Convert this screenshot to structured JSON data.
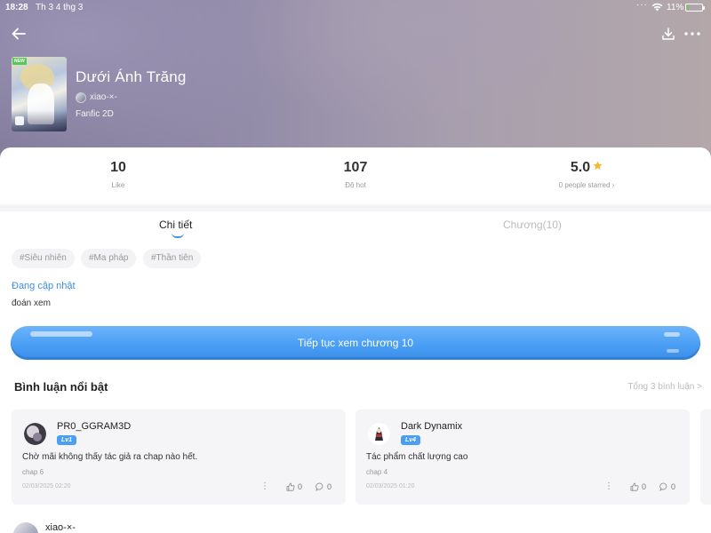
{
  "status_bar": {
    "time": "18:28",
    "date": "Th 3 4 thg 3",
    "battery": "11%",
    "battery_level": 0.11,
    "battery_color": "#5fd35f"
  },
  "nav": {
    "back_icon": "arrow-left-icon",
    "download_icon": "download-icon",
    "more_icon": "more-horizontal-icon"
  },
  "story": {
    "cover_badge": "NEW",
    "title": "Dưới Ánh Trăng",
    "author": "xiao-×-",
    "genre": "Fanfic 2D"
  },
  "stats": {
    "likes_value": "10",
    "likes_label": "Like",
    "hot_value": "107",
    "hot_label": "Độ hot",
    "rating_value": "5.0",
    "rating_label": "0 people starred ›",
    "star_color": "#f5b82e"
  },
  "tabs": [
    {
      "label": "Chi tiết",
      "active": true
    },
    {
      "label": "Chương(10)",
      "active": false
    }
  ],
  "tags": [
    "#Siêu nhiên",
    "#Ma pháp",
    "#Thần tiên"
  ],
  "update_status": "Đang cập nhật",
  "description": "đoán xem",
  "continue_button": "Tiếp tục xem chương 10",
  "accent_color": "#4a9ff5",
  "comments": {
    "heading": "Bình luận nổi bật",
    "total": "Tổng 3 bình luận >",
    "items": [
      {
        "user": "PR0_GGRAM3D",
        "level": "Lv1",
        "text": "Chờ mãi không thấy tác giả ra chap nào hết.",
        "chapter": "chap 6",
        "time": "02/03/2025 02:20",
        "menu": "⋮",
        "likes": "0",
        "replies": "0"
      },
      {
        "user": "Dark Dynamix",
        "level": "Lv4",
        "text": "Tác phẩm chất lượng cao",
        "chapter": "chap 4",
        "time": "02/03/2025 01:20",
        "menu": "⋮",
        "likes": "0",
        "replies": "0"
      }
    ]
  },
  "bottom_user": "xiao-×-"
}
